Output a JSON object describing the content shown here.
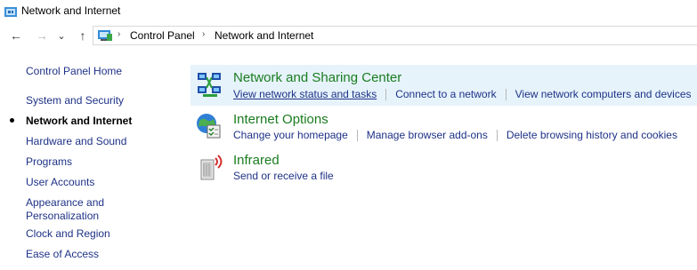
{
  "window": {
    "title": "Network and Internet",
    "icon": "network-folder-icon"
  },
  "nav": {
    "back": "←",
    "forward": "→",
    "recent": "⌄",
    "up": "↑",
    "breadcrumb": [
      "Control Panel",
      "Network and Internet"
    ]
  },
  "sidebar": {
    "items": [
      {
        "label": "Control Panel Home",
        "active": false
      },
      {
        "label": "System and Security",
        "active": false
      },
      {
        "label": "Network and Internet",
        "active": true
      },
      {
        "label": "Hardware and Sound",
        "active": false
      },
      {
        "label": "Programs",
        "active": false
      },
      {
        "label": "User Accounts",
        "active": false
      },
      {
        "label": "Appearance and Personalization",
        "active": false
      },
      {
        "label": "Clock and Region",
        "active": false
      },
      {
        "label": "Ease of Access",
        "active": false
      }
    ]
  },
  "categories": [
    {
      "title": "Network and Sharing Center",
      "icon": "network-sharing-center-icon",
      "highlighted": true,
      "links": [
        "View network status and tasks",
        "Connect to a network",
        "View network computers and devices"
      ]
    },
    {
      "title": "Internet Options",
      "icon": "internet-options-icon",
      "highlighted": false,
      "links": [
        "Change your homepage",
        "Manage browser add-ons",
        "Delete browsing history and cookies"
      ]
    },
    {
      "title": "Infrared",
      "icon": "infrared-icon",
      "highlighted": false,
      "links": [
        "Send or receive a file"
      ]
    }
  ],
  "colors": {
    "link": "#1e3287",
    "category_title": "#1a7c20",
    "highlight_bg": "#e6f3fb"
  }
}
